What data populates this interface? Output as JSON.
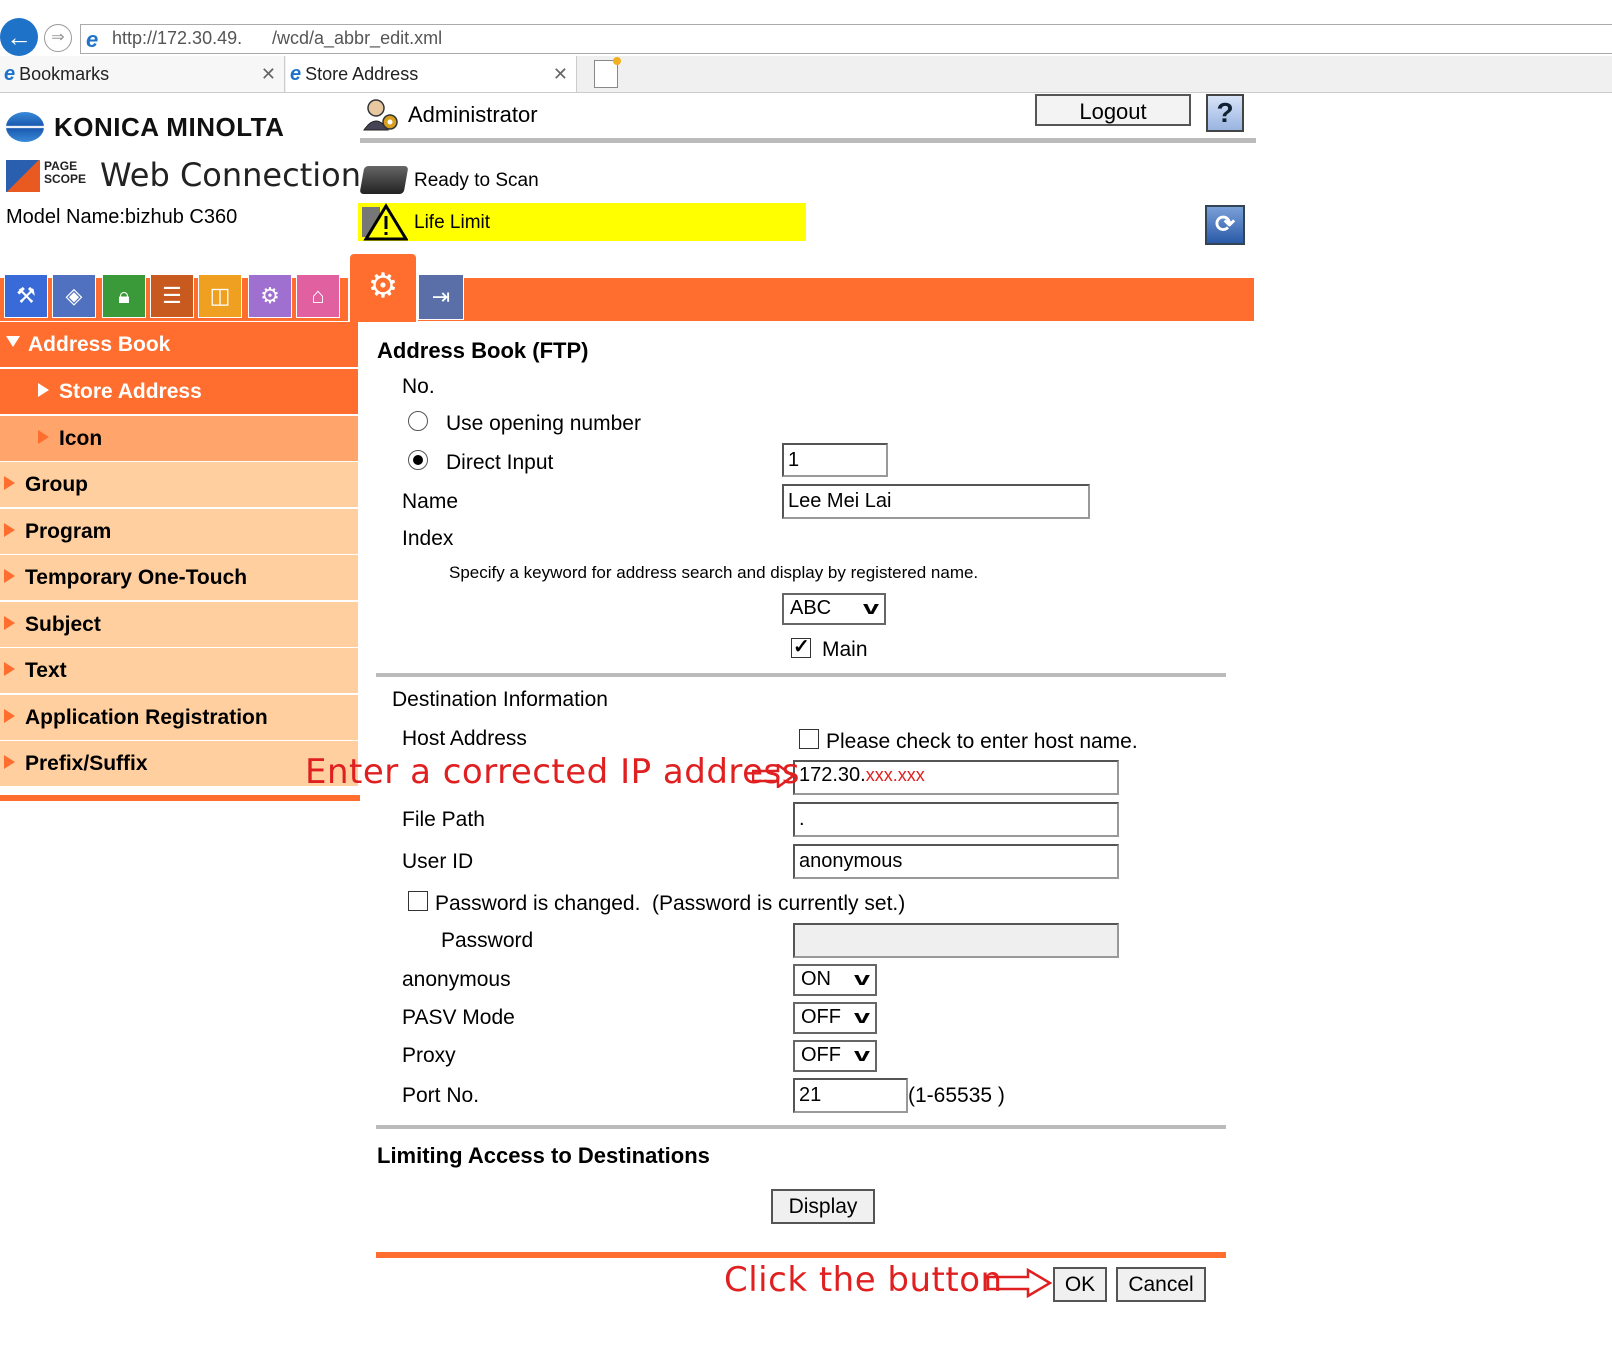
{
  "browser": {
    "url_part1": "http://172.30.49.",
    "url_part2": "/wcd/a_abbr_edit.xml",
    "tabs": [
      {
        "label": "Bookmarks"
      },
      {
        "label": "Store Address"
      }
    ]
  },
  "header": {
    "brand": "KONICA MINOLTA",
    "pagescope_line1": "PAGE",
    "pagescope_line2": "SCOPE",
    "product": "Web Connection",
    "model": "Model Name:bizhub C360",
    "user": "Administrator",
    "logout_label": "Logout",
    "help_label": "?",
    "status_ready": "Ready to Scan",
    "status_warning": "Life Limit"
  },
  "sidebar": {
    "header": "Address Book",
    "items": [
      {
        "label": "Store Address"
      },
      {
        "label": "Icon"
      },
      {
        "label": "Group"
      },
      {
        "label": "Program"
      },
      {
        "label": "Temporary One-Touch"
      },
      {
        "label": "Subject"
      },
      {
        "label": "Text"
      },
      {
        "label": "Application Registration"
      },
      {
        "label": "Prefix/Suffix"
      }
    ]
  },
  "form": {
    "title": "Address Book (FTP)",
    "no_label": "No.",
    "opt_opening": "Use opening number",
    "opt_direct": "Direct Input",
    "number_value": "1",
    "name_label": "Name",
    "name_value": "Lee Mei Lai",
    "index_label": "Index",
    "index_hint": "Specify a keyword for address search and display by registered name.",
    "index_value": "ABC",
    "main_label": "Main",
    "dest_title": "Destination Information",
    "host_label": "Host Address",
    "host_check_label": "Please check to enter host name.",
    "host_value_prefix": "172.30.",
    "host_value_masked": "xxx.xxx",
    "filepath_label": "File Path",
    "filepath_value": ".",
    "userid_label": "User ID",
    "userid_value": "anonymous",
    "pw_changed_label": "Password is changed.",
    "pw_set_note": "(Password is currently set.)",
    "password_label": "Password",
    "anonymous_label": "anonymous",
    "anonymous_value": "ON",
    "pasv_label": "PASV Mode",
    "pasv_value": "OFF",
    "proxy_label": "Proxy",
    "proxy_value": "OFF",
    "port_label": "Port No.",
    "port_value": "21",
    "port_range": "(1-65535 )",
    "limit_title": "Limiting Access to Destinations",
    "display_label": "Display",
    "ok_label": "OK",
    "cancel_label": "Cancel"
  },
  "annotations": {
    "enter_ip": "Enter a corrected IP address",
    "click_button": "Click the button"
  },
  "colors": {
    "accent": "#ff6e2e",
    "warning": "#ffff00",
    "annotation": "#e02020"
  }
}
